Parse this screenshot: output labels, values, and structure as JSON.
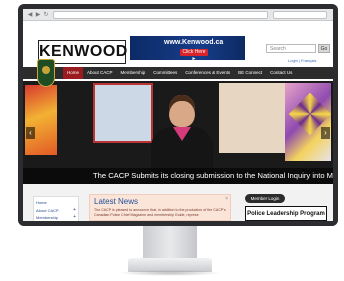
{
  "brand": {
    "logo_text": "KENWOOD",
    "banner_url": "www.Kenwood.ca",
    "banner_button": "Click Here ►"
  },
  "header": {
    "search_placeholder": "Search",
    "go_label": "Go",
    "login_link": "Login | Français"
  },
  "nav": {
    "items": [
      "Home",
      "About CACP",
      "Membership",
      "Committees",
      "Conferences & Events",
      "BE Connect",
      "Contact Us"
    ]
  },
  "hero": {
    "caption": "The CACP Submits its closing submission to the National Inquiry into MMIWG",
    "prev_label": "‹",
    "next_label": "›"
  },
  "sidebar": {
    "items": [
      "Home",
      "About CACP",
      "Membership"
    ]
  },
  "news": {
    "title": "Latest News",
    "text": "The CACP is pleased to announce that, in addition to the production of the CACP's Canadian Police Chief Magazine and membership Guide, represe"
  },
  "right_panel": {
    "member_login": "Member Login",
    "program_title": "Police Leadership Program"
  },
  "colors": {
    "nav_bg": "#2c2c2c",
    "nav_active": "#9b1c20",
    "news_bg": "#fbe4d8",
    "banner_bg": "#0c2a66"
  }
}
